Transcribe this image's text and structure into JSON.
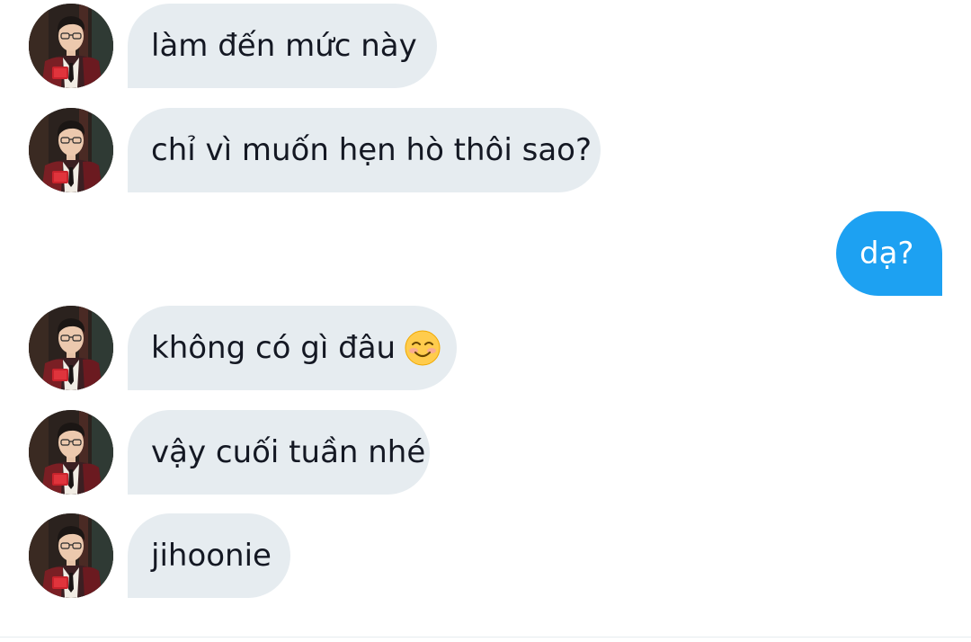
{
  "messages": [
    {
      "direction": "incoming",
      "text": "làm đến mức này"
    },
    {
      "direction": "incoming",
      "text": "chỉ vì muốn hẹn hò thôi sao?"
    },
    {
      "direction": "outgoing",
      "text": "dạ?"
    },
    {
      "direction": "incoming",
      "text": "không có gì đâu",
      "emoji": "smiling-face-icon"
    },
    {
      "direction": "incoming",
      "text": "vậy cuối tuần nhé"
    },
    {
      "direction": "incoming",
      "text": "jihoonie"
    }
  ],
  "colors": {
    "incoming_bubble": "#e6ecf0",
    "outgoing_bubble": "#1da1f2",
    "incoming_text": "#141823",
    "outgoing_text": "#ffffff"
  },
  "icons": {
    "avatar": "contact-avatar-photo",
    "emoji": "smiling-face-icon"
  }
}
